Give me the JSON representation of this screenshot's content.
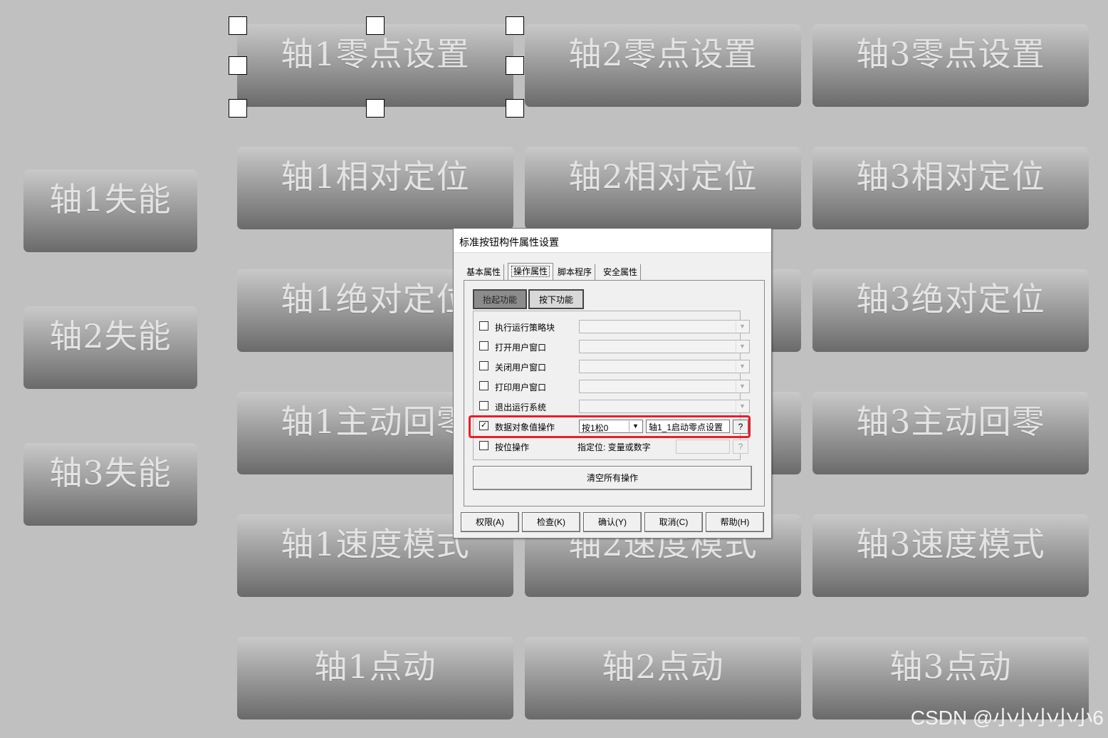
{
  "buttons": {
    "axis1_zero": "轴1零点设置",
    "axis2_zero": "轴2零点设置",
    "axis3_zero": "轴3零点设置",
    "axis1_rel": "轴1相对定位",
    "axis2_rel": "轴2相对定位",
    "axis3_rel": "轴3相对定位",
    "axis1_abs": "轴1绝对定位",
    "axis3_abs": "轴3绝对定位",
    "axis1_home": "轴1主动回零",
    "axis3_home": "轴3主动回零",
    "axis1_speed": "轴1速度模式",
    "axis2_speed": "轴2速度模式",
    "axis3_speed": "轴3速度模式",
    "axis1_jog": "轴1点动",
    "axis2_jog": "轴2点动",
    "axis3_jog": "轴3点动",
    "axis1_disable": "轴1失能",
    "axis2_disable": "轴2失能",
    "axis3_disable": "轴3失能"
  },
  "dialog": {
    "title": "标准按钮构件属性设置",
    "tabs": [
      "基本属性",
      "操作属性",
      "脚本程序",
      "安全属性"
    ],
    "subtabs": {
      "release": "抬起功能",
      "press": "按下功能"
    },
    "rows": [
      {
        "label": "执行运行策略块",
        "checked": false
      },
      {
        "label": "打开用户窗口",
        "checked": false
      },
      {
        "label": "关闭用户窗口",
        "checked": false
      },
      {
        "label": "打印用户窗口",
        "checked": false
      },
      {
        "label": "退出运行系统",
        "checked": false
      }
    ],
    "data_op": {
      "label": "数据对象值操作",
      "check_mark": "✓",
      "mode": "按1松0",
      "target": "轴1_1启动零点设置",
      "help": "?"
    },
    "bit_op": {
      "label": "按位操作",
      "hint": "指定位: 变量或数字",
      "help": "?"
    },
    "clear_all": "清空所有操作",
    "footer": {
      "permission": "权限(A)",
      "check": "检查(K)",
      "confirm": "确认(Y)",
      "cancel": "取消(C)",
      "help": "帮助(H)"
    }
  },
  "watermark": "CSDN @小小小小小6",
  "colors": {
    "highlight": "#ee1c24",
    "canvas": "#c0c0c0"
  }
}
